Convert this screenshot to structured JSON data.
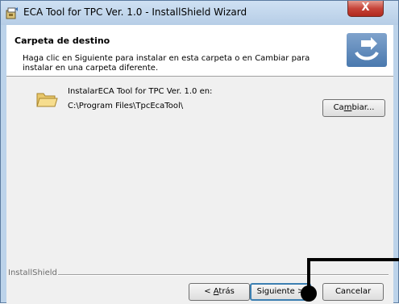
{
  "window": {
    "title": "ECA Tool for TPC Ver. 1.0 - InstallShield Wizard",
    "close_glyph": "X"
  },
  "header": {
    "title": "Carpeta de destino",
    "description": "Haga clic en Siguiente para instalar en esta carpeta o en Cambiar para instalar en una carpeta diferente."
  },
  "destination": {
    "label": "InstalarECA Tool for TPC Ver. 1.0 en:",
    "path": "C:\\Program Files\\TpcEcaTool\\",
    "change_button_prefix": "Ca",
    "change_button_mnemonic": "m",
    "change_button_suffix": "biar..."
  },
  "footer": {
    "brand": "InstallShield",
    "back_prefix": "< ",
    "back_mnemonic": "A",
    "back_suffix": "trás",
    "next_label": "Siguiente >",
    "cancel_label": "Cancelar"
  },
  "icons": {
    "title_icon": "installer-icon",
    "folder_icon": "folder-icon",
    "header_graphic": "install-arrow-graphic"
  },
  "colors": {
    "titlebar": "#b6cde6",
    "close_button": "#c6443a",
    "dialog_background": "#f0f0f0",
    "default_button_border": "#3c7fb1"
  }
}
